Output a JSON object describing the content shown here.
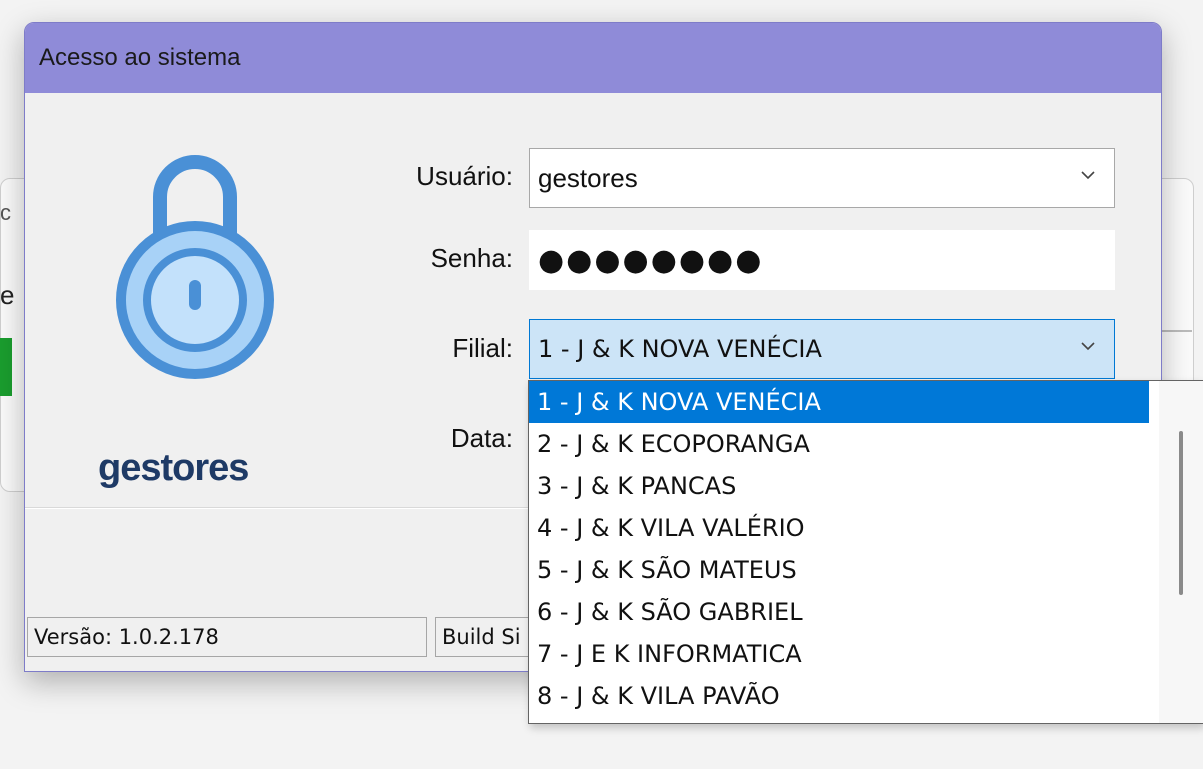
{
  "dialog": {
    "title": "Acesso ao sistema",
    "brand": "gestores",
    "fields": {
      "usuario_label": "Usuário:",
      "usuario_value": "gestores",
      "senha_label": "Senha:",
      "senha_value": "●●●●●●●●",
      "filial_label": "Filial:",
      "filial_value": "1 - J & K NOVA VENÉCIA",
      "data_label": "Data:"
    },
    "status": {
      "version": "Versão: 1.0.2.178",
      "build": "Build Si"
    }
  },
  "filial_dropdown": {
    "options": [
      "1 - J & K NOVA VENÉCIA",
      "2 - J & K ECOPORANGA",
      "3 - J & K PANCAS",
      "4 - J & K VILA VALÉRIO",
      "5 - J & K SÃO MATEUS",
      "6 - J & K SÃO GABRIEL",
      "7 - J E K INFORMATICA",
      "8 - J & K VILA PAVÃO"
    ],
    "selected_index": 0
  },
  "background": {
    "fragment_c": "c",
    "fragment_e": "e"
  },
  "colors": {
    "titlebar": "#8f8bd8",
    "selection": "#0078d7",
    "lock_fill": "#a8d2f7",
    "lock_stroke": "#4a90d6",
    "brand": "#1e3a66"
  },
  "icons": {
    "lock": "padlock-icon",
    "dropdown": "chevron-down-icon"
  }
}
